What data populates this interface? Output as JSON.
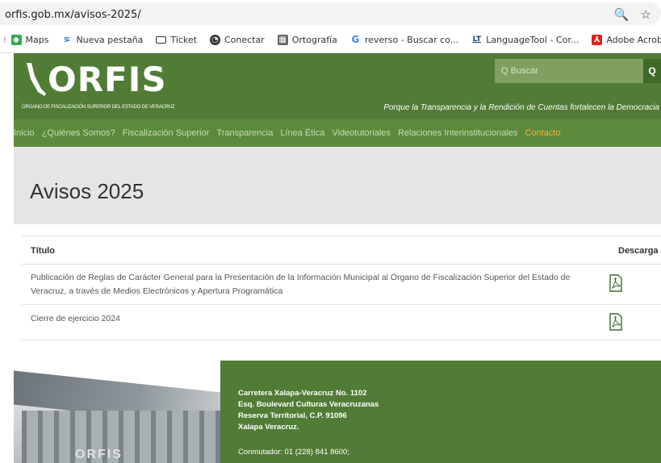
{
  "browser": {
    "url": "orfis.gob.mx/avisos-2025/",
    "bookmarks": [
      {
        "label": "Maps",
        "icon": "maps-icon",
        "color": "#34a853"
      },
      {
        "label": "Nueva pestaña",
        "icon": "new-tab-icon",
        "color": "#1a73e8"
      },
      {
        "label": "Ticket",
        "icon": "ticket-icon",
        "color": "#333333"
      },
      {
        "label": "Conectar",
        "icon": "globe-icon",
        "color": "#333333"
      },
      {
        "label": "Ortografía",
        "icon": "book-icon",
        "color": "#555555"
      },
      {
        "label": "reverso - Buscar co...",
        "icon": "google-icon",
        "color": "#4285f4"
      },
      {
        "label": "LanguageTool - Cor...",
        "icon": "languagetool-icon",
        "color": "#1a3a7a"
      },
      {
        "label": "Adobe Acrobat",
        "icon": "acrobat-icon",
        "color": "#e2231a"
      }
    ]
  },
  "header": {
    "logo": "ORFIS",
    "logo_sub": "ÓRGANO DE FISCALIZACIÓN SUPERIOR DEL ESTADO DE VERACRUZ",
    "search_placeholder": "Q Buscar",
    "tagline": "Porque la Transparencia y la Rendición de Cuentas fortalecen la Democracia",
    "brand_color": "#507c35"
  },
  "nav": [
    {
      "label": "Inicio",
      "active": false
    },
    {
      "label": "¿Quiénes Somos?",
      "active": false
    },
    {
      "label": "Fiscalización Superior",
      "active": false
    },
    {
      "label": "Transparencia",
      "active": false
    },
    {
      "label": "Línea Ética",
      "active": false
    },
    {
      "label": "Videotutoriales",
      "active": false
    },
    {
      "label": "Relaciones Interinstitucionales",
      "active": false
    },
    {
      "label": "Contacto",
      "active": true
    }
  ],
  "page": {
    "title": "Avisos 2025"
  },
  "table": {
    "headers": {
      "title": "Título",
      "download": "Descarga"
    },
    "rows": [
      {
        "title": "Publicación de Reglas de Carácter General para la Presentación de la Información Municipal al Órgano de Fiscalización Superior del Estado de Veracruz, a través de Medios Electrónicos y Apertura Programática",
        "icon": "pdf-icon"
      },
      {
        "title": "Cierre de ejercicio 2024",
        "icon": "pdf-icon"
      }
    ]
  },
  "footer": {
    "address": [
      "Carretera Xalapa-Veracruz No. 1102",
      "Esq. Boulevard Culturas Veracruzanas",
      "Reserva Territorial, C.P. 91096",
      "Xalapa Veracruz."
    ],
    "phone": "Conmutador: 01 (228) 841 8600;",
    "building_sign": "ORFIS"
  }
}
